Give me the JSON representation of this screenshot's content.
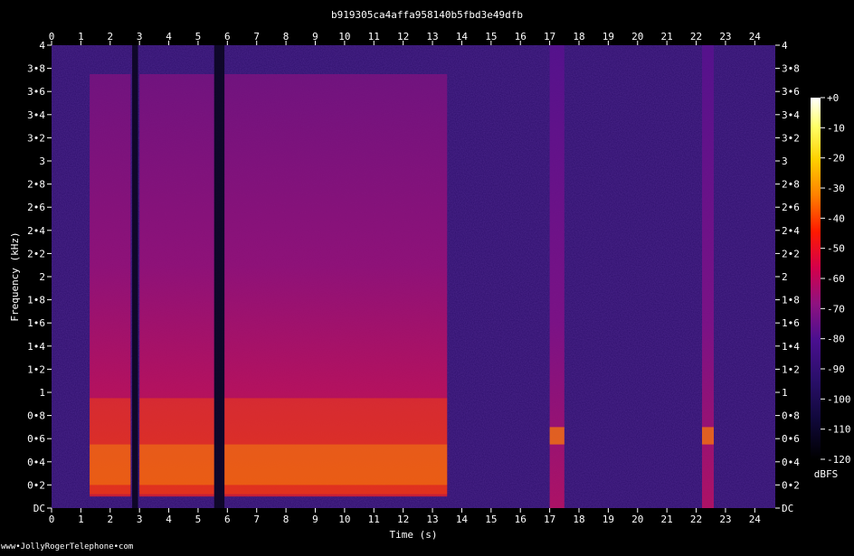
{
  "chart_data": {
    "type": "heatmap",
    "title": "b919305ca4affa958140b5fbd3e49dfb",
    "xlabel": "Time (s)",
    "ylabel": "Frequency (kHz)",
    "xlim": [
      0,
      24.7
    ],
    "ylim": [
      0,
      4.0
    ],
    "x_ticks": [
      0,
      1,
      2,
      3,
      4,
      5,
      6,
      7,
      8,
      9,
      10,
      11,
      12,
      13,
      14,
      15,
      16,
      17,
      18,
      19,
      20,
      21,
      22,
      23,
      24
    ],
    "y_ticks": [
      {
        "value": 0.0,
        "label": "DC"
      },
      {
        "value": 0.2,
        "label": "0•2"
      },
      {
        "value": 0.4,
        "label": "0•4"
      },
      {
        "value": 0.6,
        "label": "0•6"
      },
      {
        "value": 0.8,
        "label": "0•8"
      },
      {
        "value": 1.0,
        "label": "1"
      },
      {
        "value": 1.2,
        "label": "1•2"
      },
      {
        "value": 1.4,
        "label": "1•4"
      },
      {
        "value": 1.6,
        "label": "1•6"
      },
      {
        "value": 1.8,
        "label": "1•8"
      },
      {
        "value": 2.0,
        "label": "2"
      },
      {
        "value": 2.2,
        "label": "2•2"
      },
      {
        "value": 2.4,
        "label": "2•4"
      },
      {
        "value": 2.6,
        "label": "2•6"
      },
      {
        "value": 2.8,
        "label": "2•8"
      },
      {
        "value": 3.0,
        "label": "3"
      },
      {
        "value": 3.2,
        "label": "3•2"
      },
      {
        "value": 3.4,
        "label": "3•4"
      },
      {
        "value": 3.6,
        "label": "3•6"
      },
      {
        "value": 3.8,
        "label": "3•8"
      },
      {
        "value": 4.0,
        "label": "4"
      }
    ],
    "colorbar": {
      "label": "dBFS",
      "range": [
        -120,
        0
      ],
      "ticks": [
        {
          "value": 0,
          "label": "+0"
        },
        {
          "value": -10,
          "label": "-10"
        },
        {
          "value": -20,
          "label": "-20"
        },
        {
          "value": -30,
          "label": "-30"
        },
        {
          "value": -40,
          "label": "-40"
        },
        {
          "value": -50,
          "label": "-50"
        },
        {
          "value": -60,
          "label": "-60"
        },
        {
          "value": -70,
          "label": "-70"
        },
        {
          "value": -80,
          "label": "-80"
        },
        {
          "value": -90,
          "label": "-90"
        },
        {
          "value": -100,
          "label": "-100"
        },
        {
          "value": -110,
          "label": "-110"
        },
        {
          "value": -120,
          "label": "-120"
        }
      ],
      "colors": [
        "#ffffff",
        "#ffff66",
        "#ffd000",
        "#ff8000",
        "#ff1a00",
        "#d4004a",
        "#8e1280",
        "#4a0f8f",
        "#2a0f6a",
        "#10083a",
        "#000000"
      ]
    },
    "background_level_dbfs": -95,
    "speech_regions": [
      {
        "start_s": 1.3,
        "end_s": 2.7
      },
      {
        "start_s": 3.0,
        "end_s": 5.55
      },
      {
        "start_s": 5.9,
        "end_s": 13.5
      }
    ],
    "silence_regions": [
      {
        "start_s": 2.75,
        "end_s": 2.95
      },
      {
        "start_s": 5.55,
        "end_s": 5.9
      }
    ],
    "isolated_bursts": [
      {
        "start_s": 17.0,
        "end_s": 17.5
      },
      {
        "start_s": 22.2,
        "end_s": 22.6
      }
    ]
  },
  "footer": {
    "credit": "www•JollyRogerTelephone•com"
  }
}
